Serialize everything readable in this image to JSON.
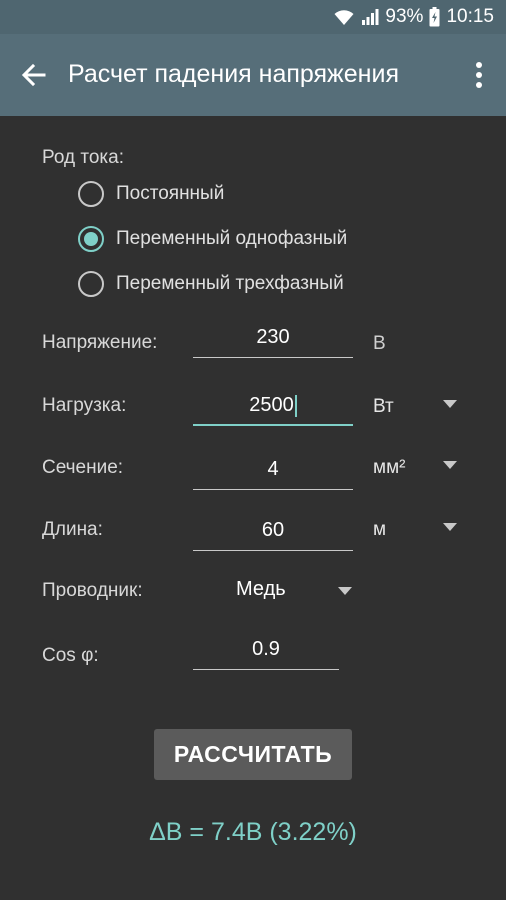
{
  "status": {
    "battery_percent": "93%",
    "time": "10:15"
  },
  "app_bar": {
    "title": "Расчет падения напряжения",
    "back_icon": "arrow-left-icon",
    "menu_icon": "more-vert-icon"
  },
  "current_type": {
    "label": "Род тока:",
    "options": [
      {
        "label": "Постоянный",
        "checked": false
      },
      {
        "label": "Переменный однофазный",
        "checked": true
      },
      {
        "label": "Переменный трехфазный",
        "checked": false
      }
    ]
  },
  "voltage": {
    "label": "Напряжение:",
    "value": "230",
    "unit": "В"
  },
  "load": {
    "label": "Нагрузка:",
    "value": "2500",
    "unit": "Вт"
  },
  "section": {
    "label": "Сечение:",
    "value": "4",
    "unit": "мм²"
  },
  "length": {
    "label": "Длина:",
    "value": "60",
    "unit": "м"
  },
  "conductor": {
    "label": "Проводник:",
    "value": "Медь"
  },
  "cos_phi": {
    "label": "Cos φ:",
    "value": "0.9"
  },
  "calculate_button": "РАССЧИТАТЬ",
  "result": "ΔВ = 7.4В  (3.22%)",
  "colors": {
    "accent": "#7fd0c8",
    "app_bar": "#566e79",
    "status_bar": "#4f6670",
    "background": "#303030",
    "button": "#5b5b5b"
  }
}
